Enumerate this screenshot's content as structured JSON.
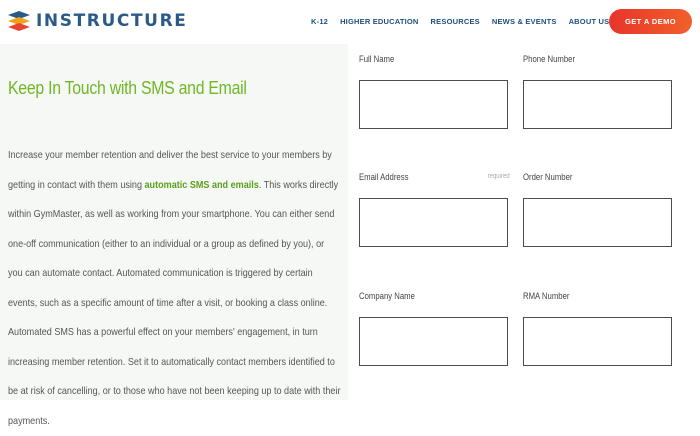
{
  "brand": {
    "name": "INSTRUCTURE",
    "logo_icon": "instructure-logo-icon"
  },
  "nav": {
    "items": [
      "K-12",
      "HIGHER EDUCATION",
      "RESOURCES",
      "NEWS & EVENTS",
      "ABOUT US"
    ],
    "cta": "GET A DEMO"
  },
  "content": {
    "heading": "Keep In Touch with SMS and Email",
    "para_before": "Increase your member retention and deliver the best service to your members by getting in contact with them using ",
    "para_link": "automatic SMS and emails",
    "para_after": ". This works directly within GymMaster, as well as working from your smartphone. You can either send one-off communication (either to an individual or a group as defined by you), or you can automate contact. Automated communication is triggered by certain events, such as a specific amount of time after a visit, or booking a class online. Automated SMS has a powerful effect on your members' engagement, in turn increasing member retention. Set it to automatically contact members identified to be at risk of cancelling, or to those who have not been keeping up to date with their payments."
  },
  "form": {
    "full_name": "Full Name",
    "phone": "Phone Number",
    "email": "Email Address",
    "required": "required",
    "order": "Order Number",
    "company": "Company Name",
    "rma": "RMA Number"
  },
  "colors": {
    "brand_blue": "#2a5a88",
    "nav_blue": "#1f4f7f",
    "cta_red": "#e8342b",
    "green": "#6fb824"
  }
}
